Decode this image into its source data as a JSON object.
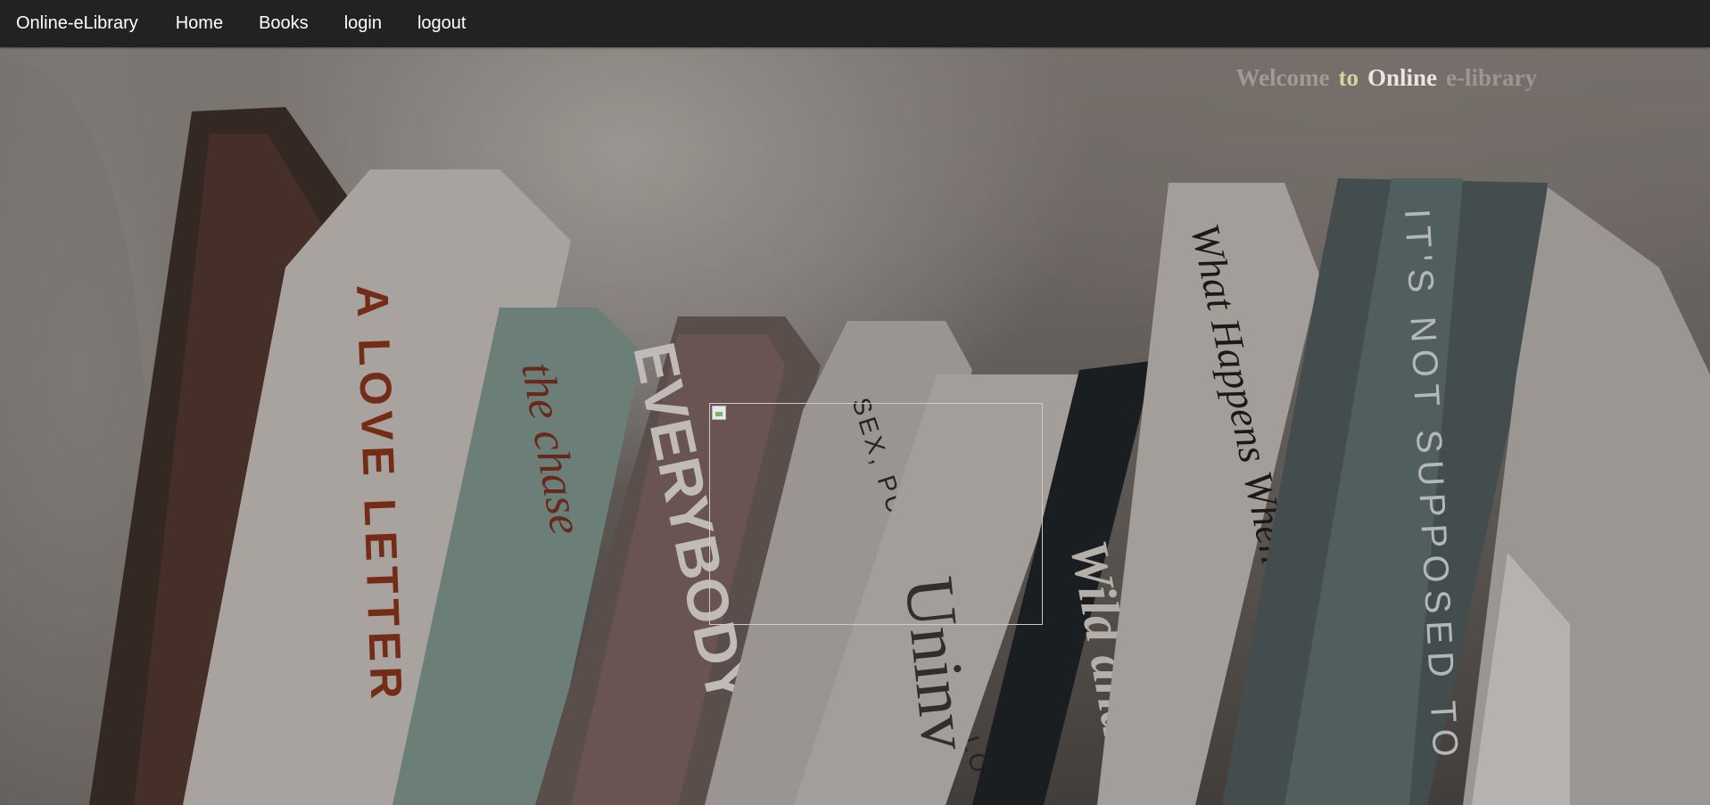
{
  "navbar": {
    "brand": "Online-eLibrary",
    "links": [
      "Home",
      "Books",
      "login",
      "logout"
    ]
  },
  "welcome": {
    "words": [
      "Welcome",
      "to",
      "Online",
      "e-library"
    ]
  },
  "hero": {
    "book_spines": [
      "A LOVE LETTER",
      "the chase",
      "EVERYBODY",
      "SEX, PURITY, AND THE LO",
      "Uninv",
      "Wild and",
      "What Happens When Wom",
      "IT'S NOT SUPPOSED TO"
    ]
  }
}
